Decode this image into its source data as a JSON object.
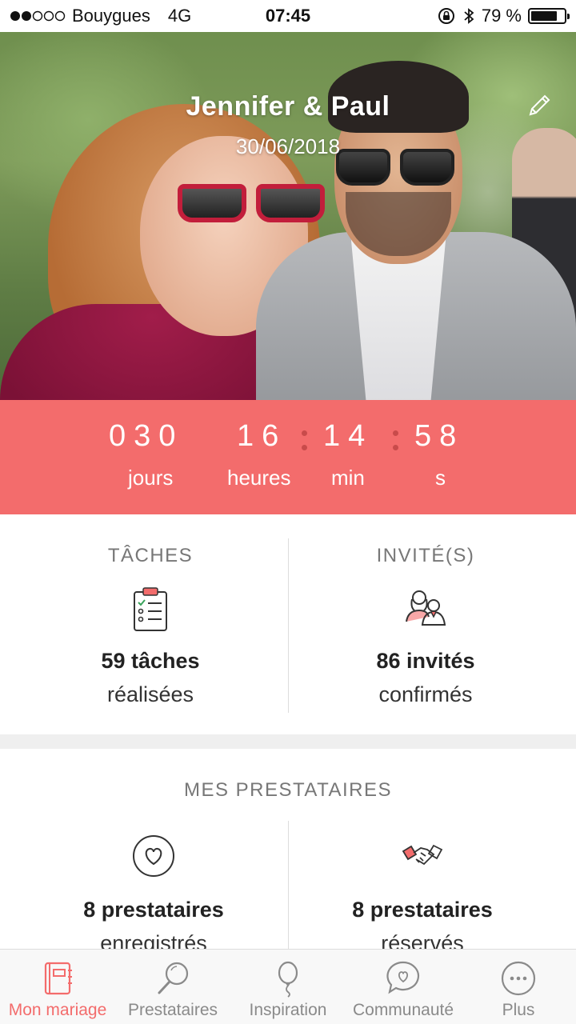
{
  "status_bar": {
    "carrier": "Bouygues",
    "network": "4G",
    "time": "07:45",
    "battery": "79 %",
    "battery_level": 0.79,
    "signal_icon": "signal-dots-icon",
    "lock_icon": "orientation-lock-icon",
    "bluetooth_icon": "bluetooth-icon"
  },
  "hero": {
    "names": "Jennifer & Paul",
    "date": "30/06/2018",
    "edit_icon": "pencil-icon"
  },
  "countdown": {
    "days": "030",
    "hours": "16",
    "minutes": "14",
    "seconds": "58",
    "days_label": "jours",
    "hours_label": "heures",
    "minutes_label": "min",
    "seconds_label": "s"
  },
  "stats": {
    "tasks": {
      "heading": "TÂCHES",
      "value": "59 tâches",
      "sub": "réalisées",
      "icon": "clipboard-checklist-icon"
    },
    "guests": {
      "heading": "INVITÉ(S)",
      "value": "86 invités",
      "sub": "confirmés",
      "icon": "couple-guests-icon"
    }
  },
  "vendors": {
    "title": "MES PRESTATAIRES",
    "saved": {
      "value": "8 prestataires",
      "sub": "enregistrés",
      "icon": "heart-circle-icon"
    },
    "booked": {
      "value": "8 prestataires",
      "sub": "réservés",
      "icon": "handshake-icon"
    }
  },
  "tabbar": {
    "items": [
      {
        "label": "Mon mariage",
        "icon": "notebook-icon",
        "active": true
      },
      {
        "label": "Prestataires",
        "icon": "magnifier-icon",
        "active": false
      },
      {
        "label": "Inspiration",
        "icon": "balloon-icon",
        "active": false
      },
      {
        "label": "Communauté",
        "icon": "chat-heart-icon",
        "active": false
      },
      {
        "label": "Plus",
        "icon": "more-dots-icon",
        "active": false
      }
    ]
  },
  "colors": {
    "accent": "#f36c6c",
    "accent_dark": "#c84b4b",
    "muted_text": "#777777",
    "tab_inactive": "#8a8a8a"
  }
}
